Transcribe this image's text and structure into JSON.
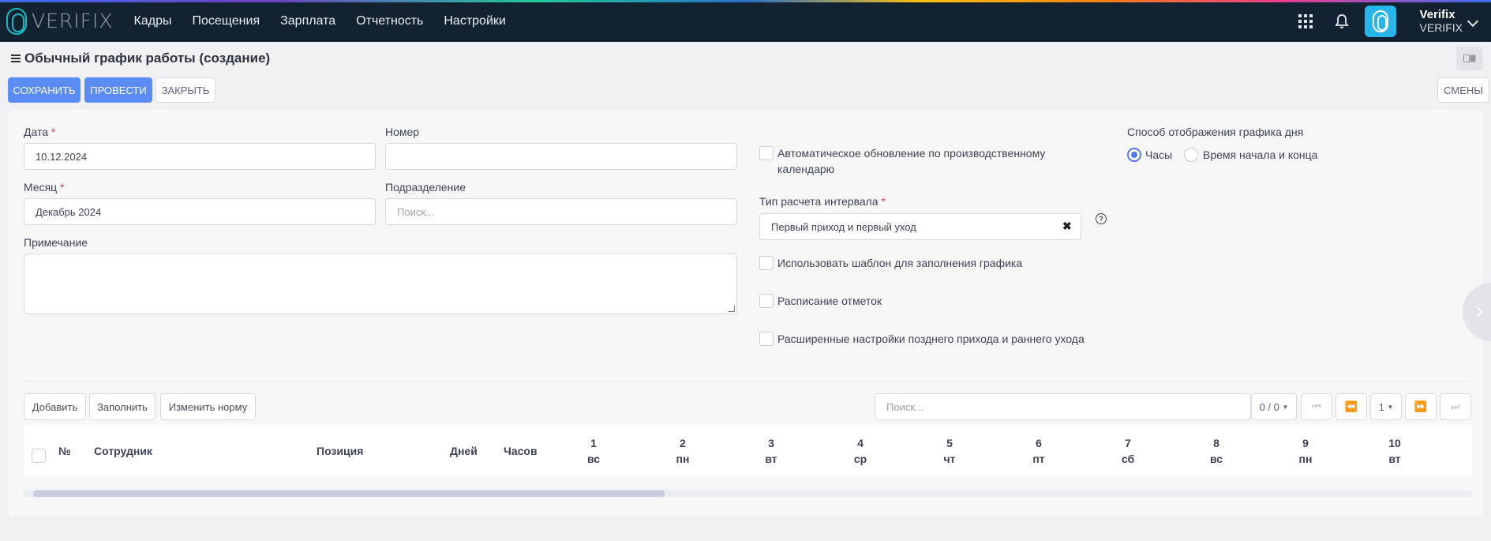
{
  "app": {
    "logo_text": "VERIFIX",
    "nav": [
      "Кадры",
      "Посещения",
      "Зарплата",
      "Отчетность",
      "Настройки"
    ],
    "user": {
      "name": "Verifix",
      "org": "VERIFIX"
    }
  },
  "page": {
    "title": "Обычный график работы (создание)",
    "lang_icon": "translate-icon"
  },
  "toolbar": {
    "save": "СОХРАНИТЬ",
    "post": "ПРОВЕСТИ",
    "close": "ЗАКРЫТЬ",
    "shifts": "СМЕНЫ"
  },
  "form": {
    "date": {
      "label": "Дата",
      "required": "*",
      "value": "10.12.2024"
    },
    "number": {
      "label": "Номер",
      "value": ""
    },
    "month": {
      "label": "Месяц",
      "required": "*",
      "value": "Декабрь 2024"
    },
    "division": {
      "label": "Подразделение",
      "placeholder": "Поиск..."
    },
    "note": {
      "label": "Примечание",
      "value": ""
    },
    "auto_update": {
      "label": "Автоматическое обновление по производственному календарю",
      "checked": false
    },
    "interval_type": {
      "label": "Тип расчета интервала",
      "required": "*",
      "value": "Первый приход и первый уход",
      "clear": "✖",
      "help": "?"
    },
    "use_template": {
      "label": "Использовать шаблон для заполнения графика",
      "checked": false
    },
    "marks_schedule": {
      "label": "Расписание отметок",
      "checked": false
    },
    "advanced": {
      "label": "Расширенные настройки позднего прихода и раннего ухода",
      "checked": false
    },
    "display_mode": {
      "label": "Способ отображения графика дня",
      "options": [
        "Часы",
        "Время начала и конца"
      ],
      "selected": "Часы"
    }
  },
  "grid_toolbar": {
    "add": "Добавить",
    "fill": "Заполнить",
    "change_norm": "Изменить норму",
    "search_placeholder": "Поиск...",
    "count": "0 / 0",
    "page": "1"
  },
  "table": {
    "columns": [
      "№",
      "Сотрудник",
      "Позиция",
      "Дней",
      "Часов"
    ],
    "days": [
      {
        "num": "1",
        "wd": "вс"
      },
      {
        "num": "2",
        "wd": "пн"
      },
      {
        "num": "3",
        "wd": "вт"
      },
      {
        "num": "4",
        "wd": "ср"
      },
      {
        "num": "5",
        "wd": "чт"
      },
      {
        "num": "6",
        "wd": "пт"
      },
      {
        "num": "7",
        "wd": "сб"
      },
      {
        "num": "8",
        "wd": "вс"
      },
      {
        "num": "9",
        "wd": "пн"
      },
      {
        "num": "10",
        "wd": "вт"
      }
    ]
  },
  "colors": {
    "topbar": "#132230",
    "primary": "#5b8cf6",
    "radio_active": "#4b7bec",
    "required": "#f1416c"
  }
}
